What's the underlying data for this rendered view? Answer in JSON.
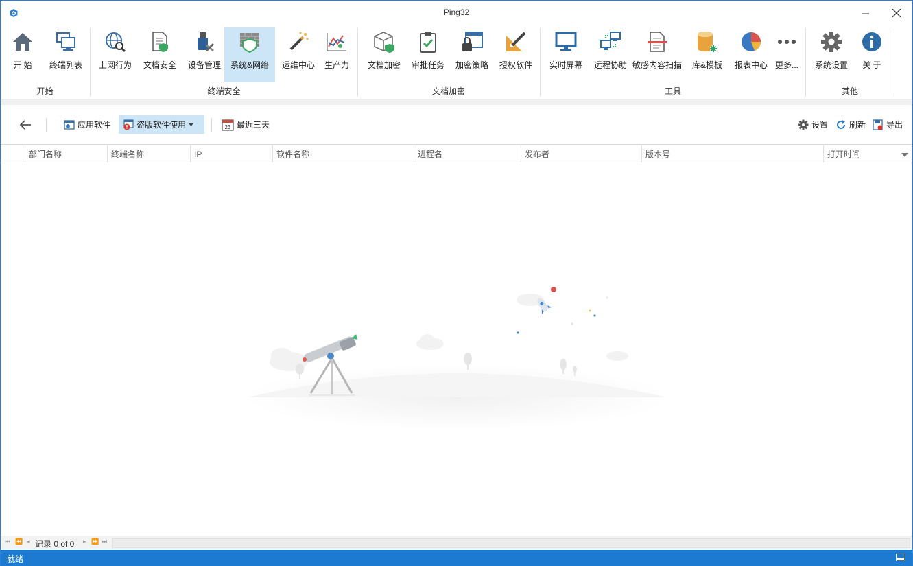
{
  "window": {
    "title": "Ping32"
  },
  "ribbon": {
    "groups": [
      {
        "label": "开始",
        "buttons": [
          {
            "label": "开  始",
            "icon": "home-icon"
          },
          {
            "label": "终端列表",
            "icon": "monitors-icon"
          }
        ]
      },
      {
        "label": "终端安全",
        "buttons": [
          {
            "label": "上网行为",
            "icon": "globe-search-icon"
          },
          {
            "label": "文档安全",
            "icon": "doc-shield-icon"
          },
          {
            "label": "设备管理",
            "icon": "usb-tools-icon"
          },
          {
            "label": "系统&网络",
            "icon": "firewall-shield-icon",
            "active": true
          },
          {
            "label": "运维中心",
            "icon": "magic-wand-icon"
          },
          {
            "label": "生产力",
            "icon": "productivity-chart-icon"
          }
        ]
      },
      {
        "label": "文档加密",
        "buttons": [
          {
            "label": "文档加密",
            "icon": "box-shield-icon"
          },
          {
            "label": "审批任务",
            "icon": "clipboard-check-icon"
          },
          {
            "label": "加密策略",
            "icon": "lock-window-icon"
          },
          {
            "label": "授权软件",
            "icon": "ruler-pencil-icon"
          }
        ]
      },
      {
        "label": "工具",
        "buttons": [
          {
            "label": "实时屏幕",
            "icon": "screen-icon"
          },
          {
            "label": "远程协助",
            "icon": "remote-icon"
          },
          {
            "label": "敏感内容扫描",
            "icon": "scan-doc-icon"
          },
          {
            "label": "库&模板",
            "icon": "database-icon"
          },
          {
            "label": "报表中心",
            "icon": "pie-chart-icon"
          },
          {
            "label": "更多...",
            "icon": "more-dots-icon"
          }
        ]
      },
      {
        "label": "其他",
        "buttons": [
          {
            "label": "系统设置",
            "icon": "gear-icon"
          },
          {
            "label": "关  于",
            "icon": "info-icon"
          }
        ]
      }
    ]
  },
  "toolbar": {
    "back": "back-arrow-icon",
    "app_software": "应用软件",
    "pirated_software": "盗版软件使用",
    "recent_days": "最近三天",
    "calendar_day": "23",
    "settings": "设置",
    "refresh": "刷新",
    "export": "导出"
  },
  "grid": {
    "columns": [
      "部门名称",
      "终端名称",
      "IP",
      "软件名称",
      "进程名",
      "发布者",
      "版本号",
      "打开时间"
    ],
    "rows": []
  },
  "pager": {
    "record_text": "记录 0 of 0"
  },
  "status": {
    "text": "就绪"
  },
  "colors": {
    "accent": "#1c7bd1",
    "active_bg": "#cde6f7"
  }
}
